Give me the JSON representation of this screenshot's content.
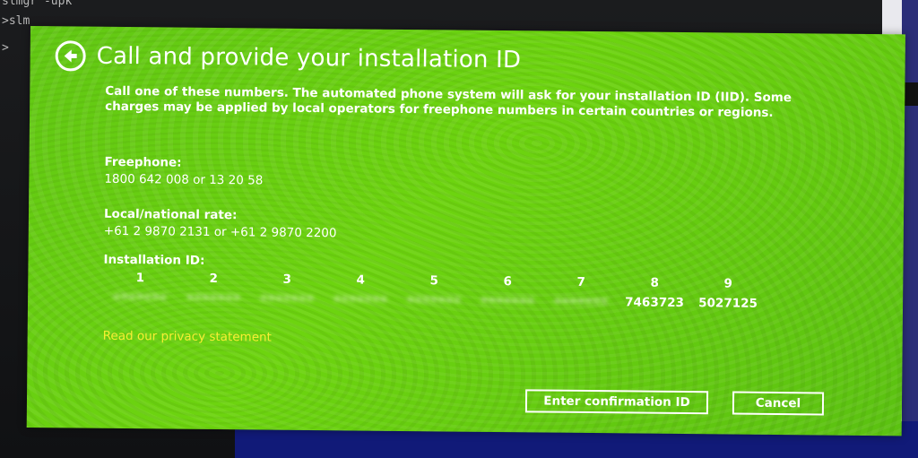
{
  "terminal": {
    "line1": "slmgr  -upk",
    "line2": ">slm",
    "line3": ">"
  },
  "dialog": {
    "title": "Call and provide your installation ID",
    "back_icon": "back-arrow-circle-icon",
    "intro": "Call one of these numbers. The automated phone system will ask for your installation ID (IID). Some charges may be applied by local operators for freephone numbers in certain countries or regions.",
    "freephone_label": "Freephone:",
    "freephone_value": "1800 642 008 or 13 20 58",
    "local_label": "Local/national rate:",
    "local_value": "+61 2 9870 2131 or +61 2 9870 2200",
    "iid_label": "Installation ID:",
    "iid_groups": [
      {
        "num": "1",
        "value": "•••••••",
        "hidden": true
      },
      {
        "num": "2",
        "value": "•••••••",
        "hidden": true
      },
      {
        "num": "3",
        "value": "•••••••",
        "hidden": true
      },
      {
        "num": "4",
        "value": "•••••••",
        "hidden": true
      },
      {
        "num": "5",
        "value": "•••••••",
        "hidden": true
      },
      {
        "num": "6",
        "value": "•••••••",
        "hidden": true
      },
      {
        "num": "7",
        "value": "•••••••",
        "hidden": true
      },
      {
        "num": "8",
        "value": "7463723",
        "hidden": false
      },
      {
        "num": "9",
        "value": "5027125",
        "hidden": false
      }
    ],
    "privacy_link": "Read our privacy statement",
    "confirm_button": "Enter confirmation ID",
    "cancel_button": "Cancel"
  },
  "colors": {
    "dialog_bg": "#64cc12",
    "link": "#f6ee34",
    "text": "#ffffff"
  }
}
